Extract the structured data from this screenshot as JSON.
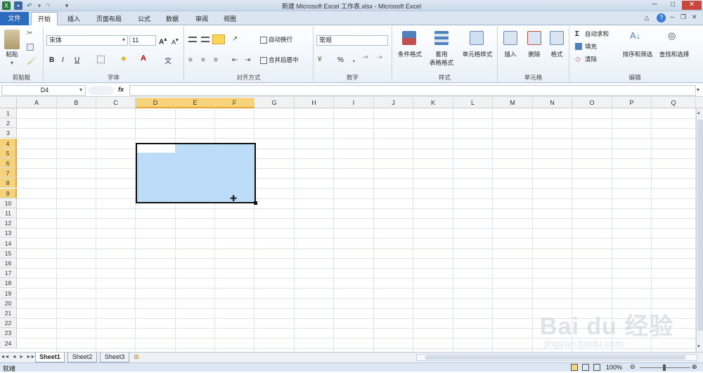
{
  "window": {
    "title": "新建 Microsoft Excel 工作表.xlsx - Microsoft Excel"
  },
  "tabs": {
    "file": "文件",
    "home": "开始",
    "insert": "插入",
    "layout": "页面布局",
    "formula": "公式",
    "data": "数据",
    "review": "审阅",
    "view": "视图"
  },
  "ribbon": {
    "clipboard": {
      "label": "剪贴板",
      "paste": "粘贴"
    },
    "font": {
      "label": "字体",
      "name": "宋体",
      "size": "11",
      "bold": "B",
      "italic": "I",
      "underline": "U"
    },
    "align": {
      "label": "对齐方式",
      "wrap": "自动换行",
      "merge": "合并后居中"
    },
    "number": {
      "label": "数字",
      "format": "常规",
      "percent": "%",
      "comma": ","
    },
    "styles": {
      "label": "样式",
      "conditional": "条件格式",
      "table_fmt_1": "套用",
      "table_fmt_2": "表格格式",
      "cell_styles": "单元格样式"
    },
    "cells": {
      "label": "单元格",
      "insert": "插入",
      "delete": "删除",
      "format": "格式"
    },
    "edit": {
      "label": "编辑",
      "autosum": "自动求和",
      "fill": "填充",
      "clear": "清除",
      "sort": "排序和筛选",
      "find": "查找和选择"
    }
  },
  "formula_bar": {
    "name_box": "D4",
    "fx": "fx",
    "value": ""
  },
  "columns": [
    "A",
    "B",
    "C",
    "D",
    "E",
    "F",
    "G",
    "H",
    "I",
    "J",
    "K",
    "L",
    "M",
    "N",
    "O",
    "P",
    "Q"
  ],
  "rows": [
    "1",
    "2",
    "3",
    "4",
    "5",
    "6",
    "7",
    "8",
    "9",
    "10",
    "11",
    "12",
    "13",
    "14",
    "15",
    "16",
    "17",
    "18",
    "19",
    "20",
    "21",
    "22",
    "23",
    "24"
  ],
  "selection": {
    "range": "D4:F9",
    "active_cell": "D4",
    "fill_color": "#bcdcf8",
    "border_color": "#111111"
  },
  "sheets": [
    "Sheet1",
    "Sheet2",
    "Sheet3"
  ],
  "status": {
    "ready": "就绪",
    "zoom": "100%"
  },
  "watermark": {
    "text": "Bai du 经验",
    "url": "jingyan.baidu.com"
  }
}
